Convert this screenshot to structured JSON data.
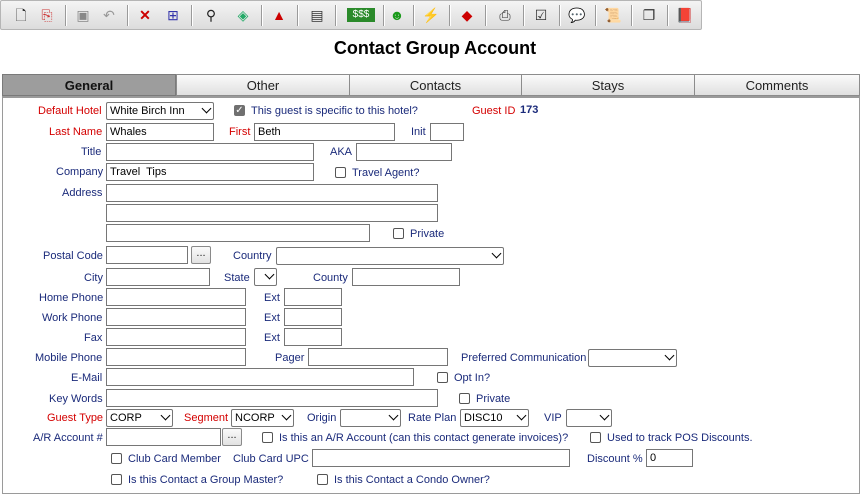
{
  "toolbar": {
    "icons": [
      "new-document-icon",
      "copy-document-icon",
      "save-icon",
      "undo-icon",
      "delete-icon",
      "compare-icon",
      "search-icon",
      "export-icon",
      "send-red-icon",
      "report-icon",
      "money-icon",
      "smiley-icon",
      "magic-wand-icon",
      "eraser-icon",
      "print-setup-icon",
      "checklist-icon",
      "comment-icon",
      "scroll-icon",
      "pages-icon",
      "book-icon"
    ]
  },
  "page_title": "Contact Group Account",
  "tabs": [
    {
      "label": "General"
    },
    {
      "label": "Other"
    },
    {
      "label": "Contacts"
    },
    {
      "label": "Stays"
    },
    {
      "label": "Comments"
    }
  ],
  "form": {
    "default_hotel": {
      "label": "Default Hotel",
      "value": "White Birch Inn"
    },
    "specific_hotel": {
      "label": "This guest is specific to this hotel?",
      "checked": true
    },
    "guest_id": {
      "label": "Guest ID",
      "value": "173"
    },
    "last_name": {
      "label": "Last Name",
      "value": "Whales"
    },
    "first": {
      "label": "First",
      "value": "Beth"
    },
    "init": {
      "label": "Init",
      "value": ""
    },
    "title": {
      "label": "Title",
      "value": ""
    },
    "aka": {
      "label": "AKA",
      "value": ""
    },
    "company": {
      "label": "Company",
      "value": "Travel  Tips"
    },
    "travel_agent": {
      "label": "Travel Agent?",
      "checked": false
    },
    "address": {
      "label": "Address",
      "line1": "",
      "line2": "",
      "line3": ""
    },
    "private1": {
      "label": "Private",
      "checked": false
    },
    "postal_code": {
      "label": "Postal Code",
      "value": "",
      "button": "..."
    },
    "country": {
      "label": "Country",
      "value": ""
    },
    "city": {
      "label": "City",
      "value": ""
    },
    "state": {
      "label": "State",
      "value": ""
    },
    "county": {
      "label": "County",
      "value": ""
    },
    "home_phone": {
      "label": "Home Phone",
      "value": ""
    },
    "work_phone": {
      "label": "Work Phone",
      "value": ""
    },
    "fax": {
      "label": "Fax",
      "value": ""
    },
    "ext_label": "Ext",
    "mobile_phone": {
      "label": "Mobile Phone",
      "value": ""
    },
    "pager": {
      "label": "Pager",
      "value": ""
    },
    "preferred_comm": {
      "label": "Preferred Communication",
      "value": ""
    },
    "email": {
      "label": "E-Mail",
      "value": ""
    },
    "opt_in": {
      "label": "Opt In?",
      "checked": false
    },
    "key_words": {
      "label": "Key Words",
      "value": ""
    },
    "private2": {
      "label": "Private",
      "checked": false
    },
    "guest_type": {
      "label": "Guest Type",
      "value": "CORP"
    },
    "segment": {
      "label": "Segment",
      "value": "NCORP"
    },
    "origin": {
      "label": "Origin",
      "value": ""
    },
    "rate_plan": {
      "label": "Rate Plan",
      "value": "DISC10"
    },
    "vip": {
      "label": "VIP",
      "value": ""
    },
    "ar_account": {
      "label": "A/R Account #",
      "value": "",
      "button": "..."
    },
    "is_ar": {
      "label": "Is this an A/R Account (can this contact generate invoices)?",
      "checked": false
    },
    "pos_discounts": {
      "label": "Used to track POS Discounts.",
      "checked": false
    },
    "club_member": {
      "label": "Club Card Member",
      "checked": false
    },
    "club_upc": {
      "label": "Club Card UPC",
      "value": ""
    },
    "discount": {
      "label": "Discount %",
      "value": "0"
    },
    "group_master": {
      "label": "Is this Contact a Group Master?",
      "checked": false
    },
    "condo_owner": {
      "label": "Is this Contact a Condo Owner?",
      "checked": false
    }
  }
}
